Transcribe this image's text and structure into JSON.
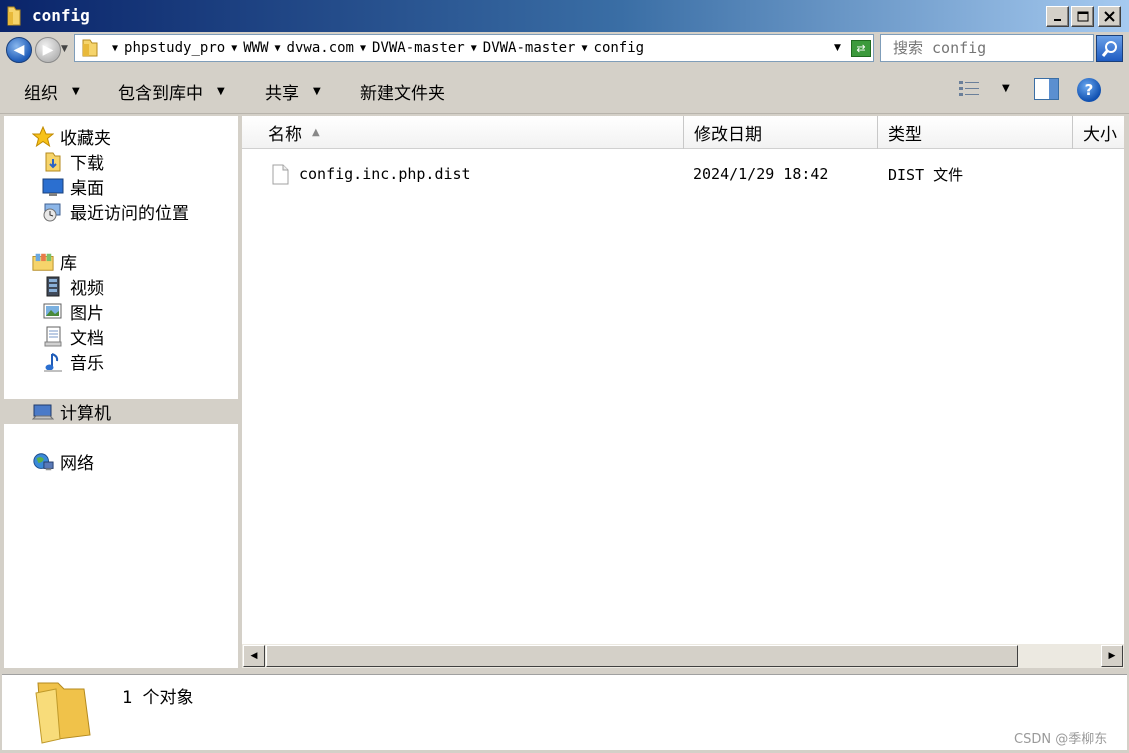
{
  "window": {
    "title": "config"
  },
  "address": {
    "crumbs": [
      "phpstudy_pro",
      "WWW",
      "dvwa.com",
      "DVWA-master",
      "DVWA-master",
      "config"
    ]
  },
  "search": {
    "placeholder": "搜索 config"
  },
  "toolbar": {
    "organize": "组织",
    "include_library": "包含到库中",
    "share": "共享",
    "new_folder": "新建文件夹"
  },
  "nav": {
    "favorites": "收藏夹",
    "downloads": "下载",
    "desktop": "桌面",
    "recent": "最近访问的位置",
    "libraries": "库",
    "videos": "视频",
    "pictures": "图片",
    "documents": "文档",
    "music": "音乐",
    "computer": "计算机",
    "network": "网络"
  },
  "columns": {
    "name": "名称",
    "modified": "修改日期",
    "type": "类型",
    "size": "大小"
  },
  "files": [
    {
      "name": "config.inc.php.dist",
      "modified": "2024/1/29 18:42",
      "type": "DIST 文件"
    }
  ],
  "status": {
    "count": "1 个对象"
  },
  "watermark": "CSDN @季柳东",
  "colors": {
    "title_start": "#0a246a",
    "title_end": "#a6caf0",
    "chrome": "#d4d0c8",
    "selection": "#d4d0c8"
  }
}
